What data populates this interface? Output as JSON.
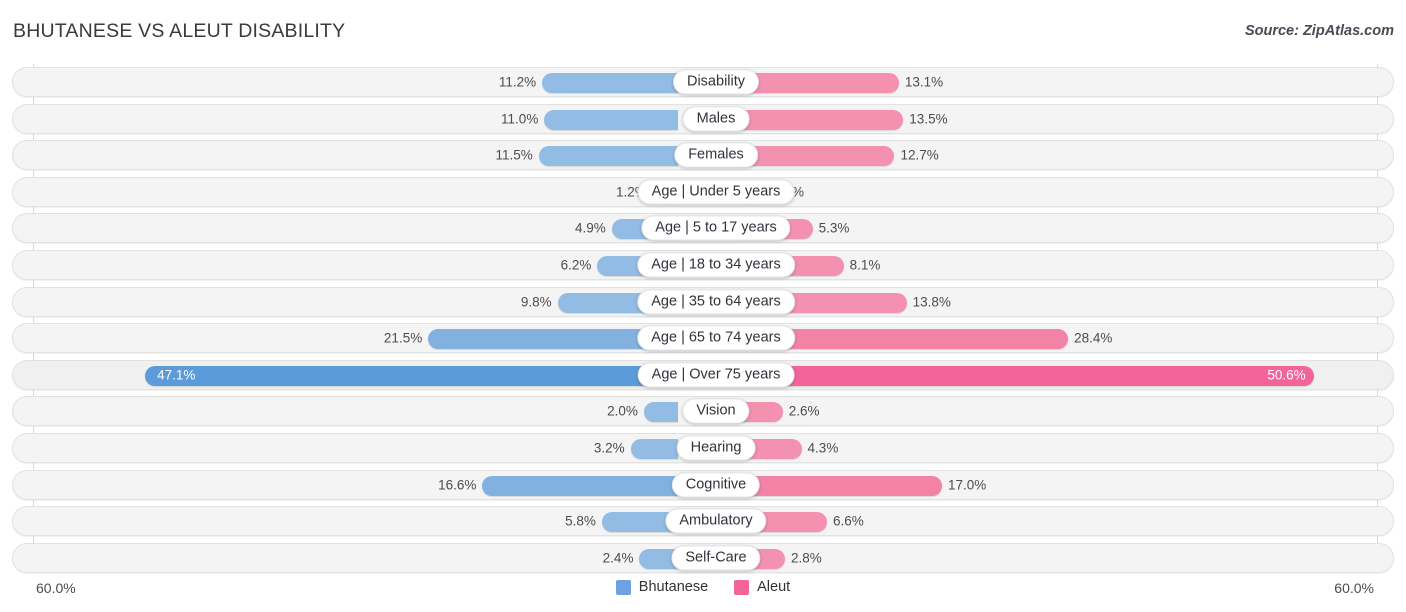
{
  "header": {
    "title": "BHUTANESE VS ALEUT DISABILITY",
    "source": "Source: ZipAtlas.com"
  },
  "axis": {
    "left_label": "60.0%",
    "right_label": "60.0%",
    "max": 60.0
  },
  "legend": [
    {
      "label": "Bhutanese",
      "color": "#6ba3de"
    },
    {
      "label": "Aleut",
      "color": "#f2649a"
    }
  ],
  "colors": {
    "left_light": "#92bce3",
    "left_mid": "#82b1e0",
    "left_strong": "#5b9bd9",
    "right_light": "#f490b0",
    "right_mid": "#f283a6",
    "right_strong": "#f2649a",
    "row_bg": "#f4f4f4",
    "row_border": "#e2e2e2",
    "gridline": "#d9d9d9"
  },
  "chart_data": {
    "type": "bar",
    "title": "BHUTANESE VS ALEUT DISABILITY",
    "subtitle": "Source: ZipAtlas.com",
    "orientation": "horizontal-diverging",
    "xlabel": "",
    "ylabel": "",
    "xlim": [
      60.0,
      60.0
    ],
    "grid": true,
    "legend_position": "bottom-center",
    "categories": [
      "Disability",
      "Males",
      "Females",
      "Age | Under 5 years",
      "Age | 5 to 17 years",
      "Age | 18 to 34 years",
      "Age | 35 to 64 years",
      "Age | 65 to 74 years",
      "Age | Over 75 years",
      "Vision",
      "Hearing",
      "Cognitive",
      "Ambulatory",
      "Self-Care"
    ],
    "series": [
      {
        "name": "Bhutanese",
        "side": "left",
        "color": "#92bce3",
        "values": [
          11.2,
          11.0,
          11.5,
          1.2,
          4.9,
          6.2,
          9.8,
          21.5,
          47.1,
          2.0,
          3.2,
          16.6,
          5.8,
          2.4
        ],
        "labels": [
          "11.2%",
          "11.0%",
          "11.5%",
          "1.2%",
          "4.9%",
          "6.2%",
          "9.8%",
          "21.5%",
          "47.1%",
          "2.0%",
          "3.2%",
          "16.6%",
          "5.8%",
          "2.4%"
        ]
      },
      {
        "name": "Aleut",
        "side": "right",
        "color": "#f490b0",
        "values": [
          13.1,
          13.5,
          12.7,
          1.2,
          5.3,
          8.1,
          13.8,
          28.4,
          50.6,
          2.6,
          4.3,
          17.0,
          6.6,
          2.8
        ],
        "labels": [
          "13.1%",
          "13.5%",
          "12.7%",
          "1.2%",
          "5.3%",
          "8.1%",
          "13.8%",
          "28.4%",
          "50.6%",
          "2.6%",
          "4.3%",
          "17.0%",
          "6.6%",
          "2.8%"
        ]
      }
    ]
  }
}
